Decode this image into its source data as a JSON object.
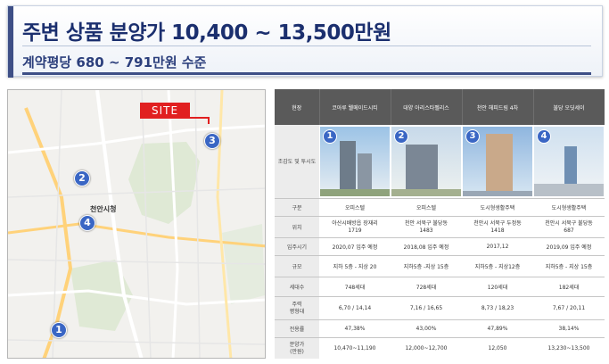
{
  "header": {
    "title": "주변 상품 분양가 10,400 ~ 13,500만원",
    "subtitle": "계약평당 680 ~ 791만원 수준"
  },
  "map": {
    "site_label": "SITE",
    "city_label": "천안시청",
    "markers": [
      "1",
      "2",
      "3",
      "4"
    ]
  },
  "table": {
    "headers": [
      "현장",
      "코아루 웰메이드시티",
      "대양 아리스타펠리스",
      "천안 헤피드림 4차",
      "불당 오딧세이"
    ],
    "image_row_label": "조감도 및 투시도",
    "rows": [
      {
        "label": "구분",
        "cells": [
          "오피스텔",
          "오피스텔",
          "도시형생활주택",
          "도시형생활주택"
        ]
      },
      {
        "label": "위치",
        "cells": [
          [
            "아산시배방읍 장재리",
            "1719"
          ],
          [
            "천안 서북구 불당동",
            "1483"
          ],
          [
            "천안시 서북구 두정동",
            "1418"
          ],
          [
            "천안시 서북구 불당동",
            "687"
          ]
        ]
      },
      {
        "label": "입주시기",
        "cells": [
          "2020,07 입주 예정",
          "2018,08 입주 예정",
          "2017,12",
          "2019,09 입주 예정"
        ]
      },
      {
        "label": "규모",
        "cells": [
          "지하 5층 - 지상 20",
          "지하5층 -지상 15층",
          "지하5층 - 지상12층",
          "지하5층 - 지상 15층"
        ]
      },
      {
        "label": "세대수",
        "cells": [
          "748세대",
          "728세대",
          "120세대",
          "182세대"
        ]
      },
      {
        "label": [
          "주력",
          "평형대"
        ],
        "cells": [
          "6,70 / 14,14",
          "7,16 / 16,65",
          "8,73 / 18,23",
          "7,67 / 20,11"
        ]
      },
      {
        "label": "전용률",
        "cells": [
          "47,38%",
          "43,00%",
          "47,89%",
          "38,14%"
        ]
      },
      {
        "label": [
          "분양가",
          "(만원)"
        ],
        "cells": [
          "10,470~11,190",
          "12,000~12,700",
          "12,050",
          "13,230~13,500"
        ]
      }
    ]
  }
}
